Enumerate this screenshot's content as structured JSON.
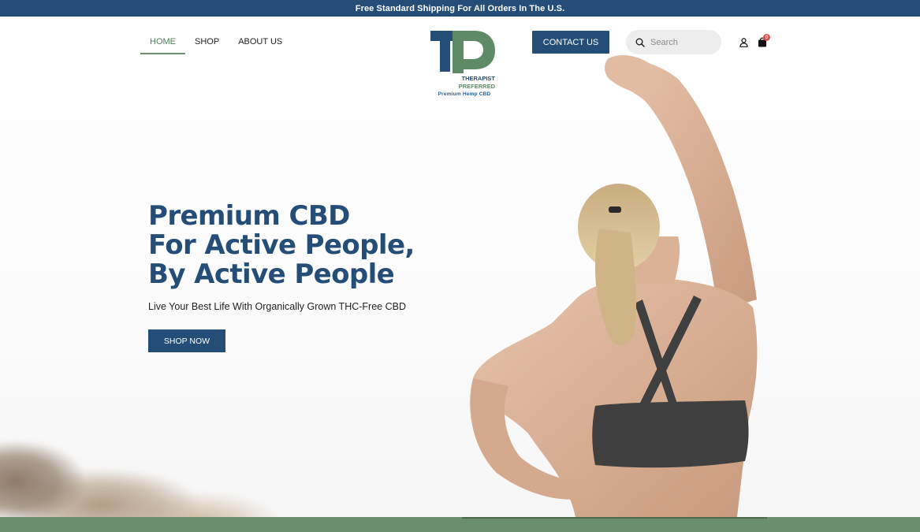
{
  "announcement": {
    "text": "Free Standard Shipping For All Orders In The U.S."
  },
  "nav": {
    "items": [
      {
        "label": "HOME",
        "active": true
      },
      {
        "label": "SHOP",
        "active": false
      },
      {
        "label": "ABOUT US",
        "active": false
      }
    ]
  },
  "logo": {
    "line1": "THERAPIST",
    "line2": "PREFERRED",
    "tagline": "Premium Hemp CBD"
  },
  "header": {
    "contact_label": "CONTACT US",
    "search_placeholder": "Search",
    "cart_count": "0"
  },
  "hero": {
    "headline_line1": "Premium CBD",
    "headline_line2": "For Active People,",
    "headline_line3": "By Active People",
    "subheadline": "Live Your Best Life With Organically Grown THC-Free CBD",
    "cta_label": "SHOP NOW"
  },
  "colors": {
    "brand_blue": "#244e78",
    "brand_green": "#6b8f6c",
    "search_bg": "#ededed"
  },
  "icons": [
    "search-icon",
    "account-icon",
    "cart-icon"
  ]
}
